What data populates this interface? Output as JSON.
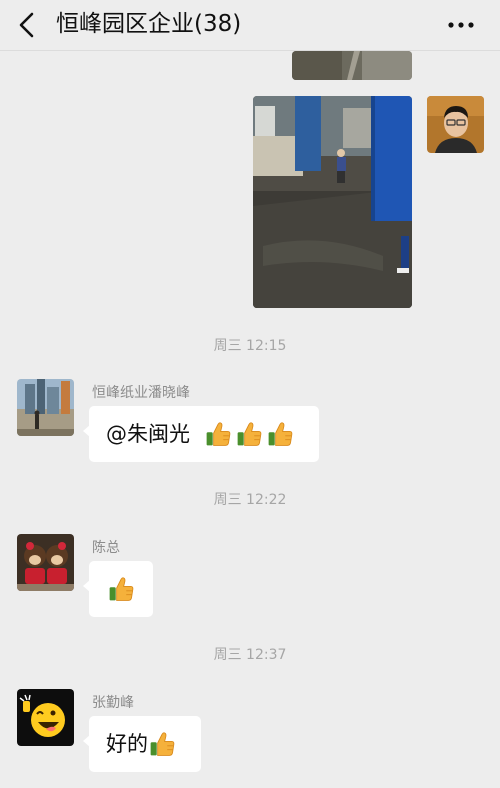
{
  "header": {
    "title": "恒峰园区企业(38)",
    "back_icon": "chevron-left-icon",
    "more_icon": "more-dots-icon"
  },
  "messages": [
    {
      "type": "timestamp",
      "text": "周三 12:15"
    },
    {
      "type": "text",
      "sender": "恒峰纸业潘晓峰",
      "text": "@朱闽光",
      "emoji": [
        "thumbs-up-icon",
        "thumbs-up-icon",
        "thumbs-up-icon"
      ]
    },
    {
      "type": "timestamp",
      "text": "周三 12:22"
    },
    {
      "type": "text",
      "sender": "陈总",
      "text": "",
      "emoji": [
        "thumbs-up-icon"
      ]
    },
    {
      "type": "timestamp",
      "text": "周三 12:37"
    },
    {
      "type": "text",
      "sender": "张勤峰",
      "text": "好的",
      "emoji": [
        "thumbs-up-icon"
      ]
    }
  ],
  "colors": {
    "background": "#ededed",
    "bubble": "#ffffff",
    "timestamp": "#a6a6a6",
    "sender_name": "#8c8c8c",
    "thumb": "#f5b13b"
  }
}
